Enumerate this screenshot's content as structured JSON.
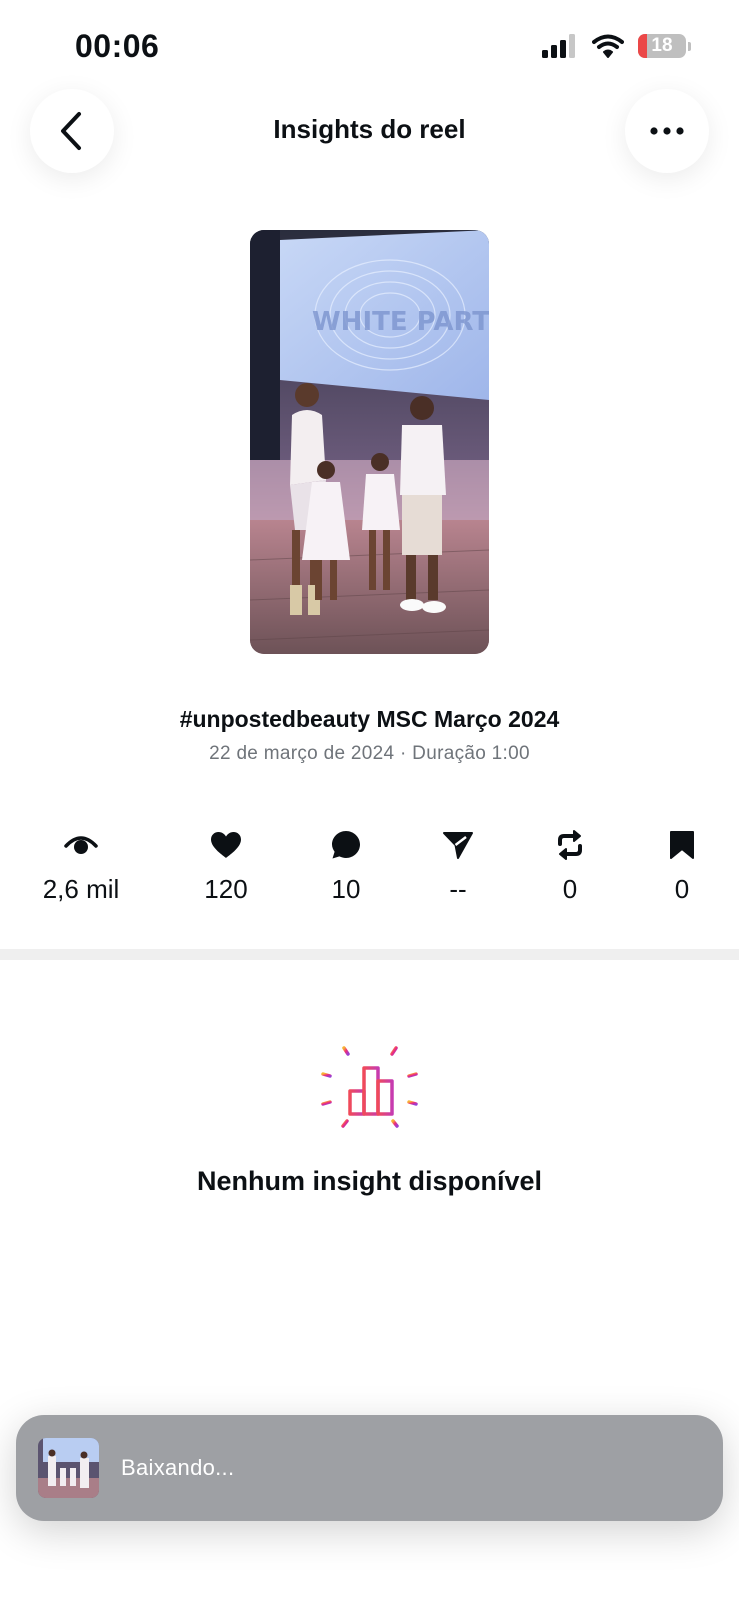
{
  "status_bar": {
    "time": "00:06",
    "battery": "18",
    "battery_level": 0.18
  },
  "header": {
    "title": "Insights do reel"
  },
  "reel": {
    "caption": "#unpostedbeauty MSC Março 2024",
    "meta": "22 de março de 2024 · Duração 1:00",
    "screen_text": "WHITE PARTY"
  },
  "stats": [
    {
      "icon": "eye-icon",
      "value": "2,6 mil"
    },
    {
      "icon": "heart-icon",
      "value": "120"
    },
    {
      "icon": "comment-icon",
      "value": "10"
    },
    {
      "icon": "share-icon",
      "value": "--"
    },
    {
      "icon": "repost-icon",
      "value": "0"
    },
    {
      "icon": "bookmark-icon",
      "value": "0"
    }
  ],
  "empty_state": {
    "title": "Nenhum insight disponível"
  },
  "toast": {
    "text": "Baixando..."
  },
  "colors": {
    "gradient": [
      "#f9b233",
      "#ee2a7b",
      "#9b3fd1"
    ],
    "battery_low": "#eb4848"
  }
}
